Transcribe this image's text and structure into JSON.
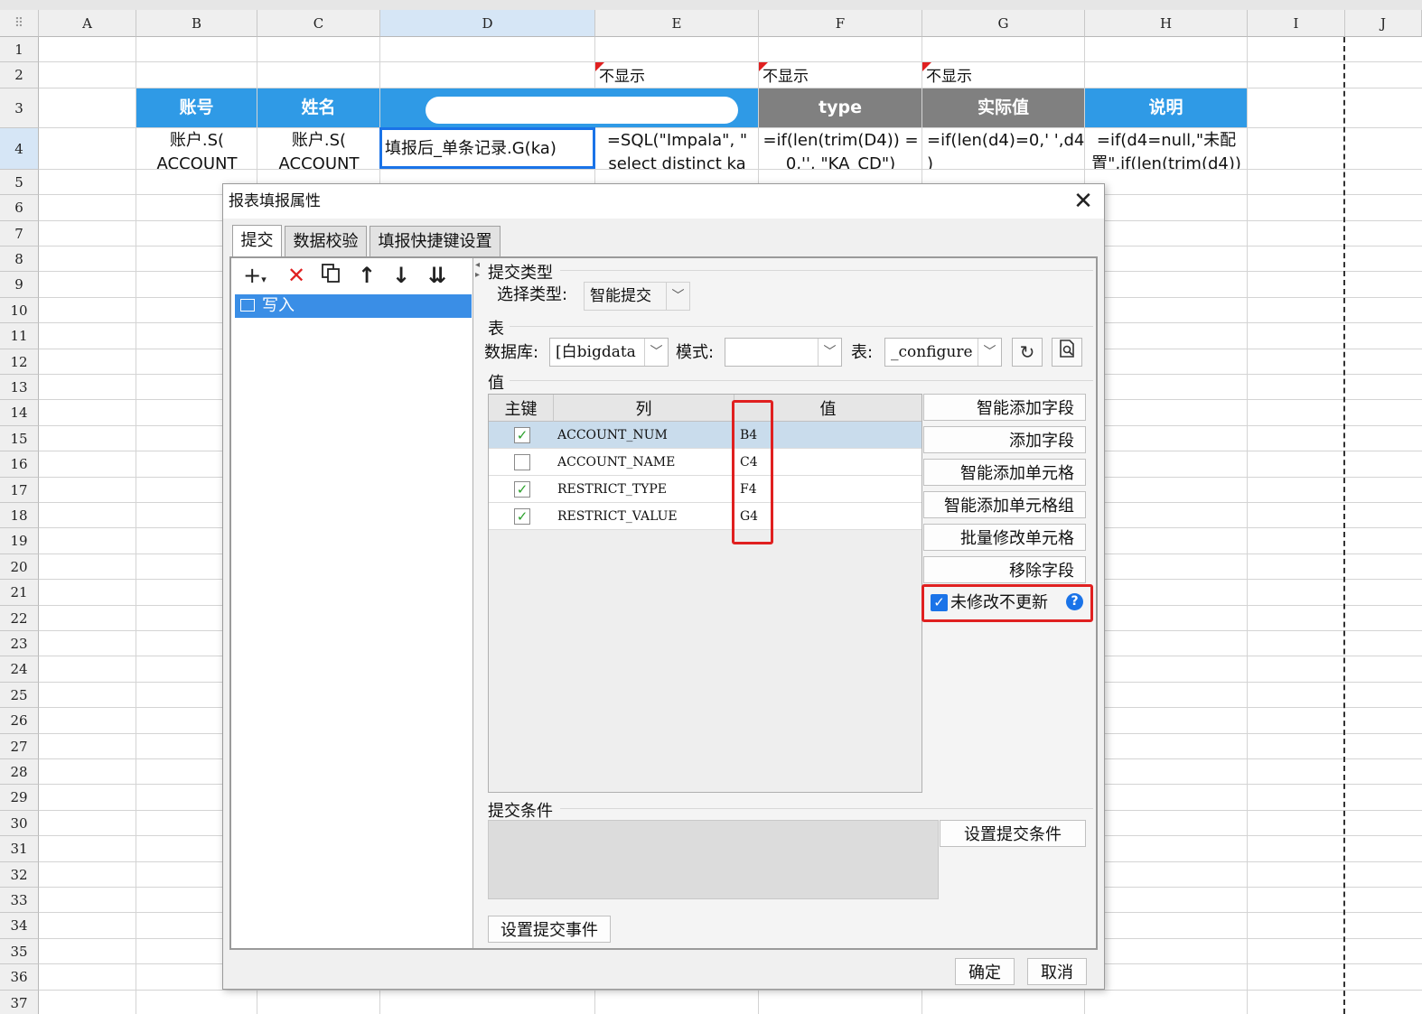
{
  "spreadsheet": {
    "columns": [
      "A",
      "B",
      "C",
      "D",
      "E",
      "F",
      "G",
      "H",
      "I",
      "J"
    ],
    "rows": [
      "1",
      "2",
      "3",
      "4",
      "5",
      "6",
      "7",
      "8",
      "9",
      "10",
      "11",
      "12",
      "13",
      "14",
      "15",
      "16",
      "17",
      "18",
      "19",
      "20",
      "21",
      "22",
      "23",
      "24",
      "25",
      "26",
      "27",
      "28",
      "29",
      "30",
      "31",
      "32",
      "33",
      "34",
      "35",
      "36",
      "37"
    ],
    "row2": {
      "e": "不显示",
      "f": "不显示",
      "g": "不显示"
    },
    "headers": {
      "b": "账号",
      "c": "姓名",
      "d": "",
      "f": "type",
      "g": "实际值",
      "h": "说明"
    },
    "row4": {
      "b1": "账户.S(",
      "b2": "ACCOUNT",
      "c1": "账户.S(",
      "c2": "ACCOUNT",
      "d1": "填报后_单条记录.G(ka)",
      "e1": "=SQL(\"Impala\", \"",
      "e2": "select distinct ka",
      "f1": "=if(len(trim(D4)) =",
      "f2": "0,'', \"KA_CD\")",
      "g1": "=if(len(d4)=0,' ',d4",
      "g2": ")",
      "h1": "=if(d4=null,\"未配",
      "h2": "置\",if(len(trim(d4))"
    },
    "colors": {
      "header_blue": "#2f9ae6",
      "header_gray": "#808080",
      "selection": "#1a73e8"
    }
  },
  "dialog": {
    "title": "报表填报属性",
    "close_glyph": "✕",
    "tabs": [
      "提交",
      "数据校验",
      "填报快捷键设置"
    ],
    "toolbar_icons": [
      "add-icon",
      "delete-icon",
      "copy-icon",
      "move-up-icon",
      "move-down-icon",
      "move-bottom-icon"
    ],
    "tree_item": "写入",
    "submit_type": {
      "section": "提交类型",
      "label": "选择类型:",
      "value": "智能提交"
    },
    "table": {
      "section": "表",
      "db_label": "数据库:",
      "db_value": "[白bigdata",
      "schema_label": "模式:",
      "schema_value": "",
      "table_label": "表:",
      "table_value": "_configure"
    },
    "values": {
      "section": "值",
      "headers": [
        "主键",
        "列",
        "值"
      ],
      "rows": [
        {
          "key": true,
          "col": "ACCOUNT_NUM",
          "val": "B4"
        },
        {
          "key": false,
          "col": "ACCOUNT_NAME",
          "val": "C4"
        },
        {
          "key": true,
          "col": "RESTRICT_TYPE",
          "val": "F4"
        },
        {
          "key": true,
          "col": "RESTRICT_VALUE",
          "val": "G4"
        }
      ]
    },
    "side_buttons": [
      "智能添加字段",
      "添加字段",
      "智能添加单元格",
      "智能添加单元格组",
      "批量修改单元格",
      "移除字段"
    ],
    "no_update_checkbox": {
      "label": "未修改不更新",
      "checked": true,
      "help": "?"
    },
    "condition": {
      "section": "提交条件",
      "button": "设置提交条件"
    },
    "event_button": "设置提交事件",
    "ok": "确定",
    "cancel": "取消"
  }
}
